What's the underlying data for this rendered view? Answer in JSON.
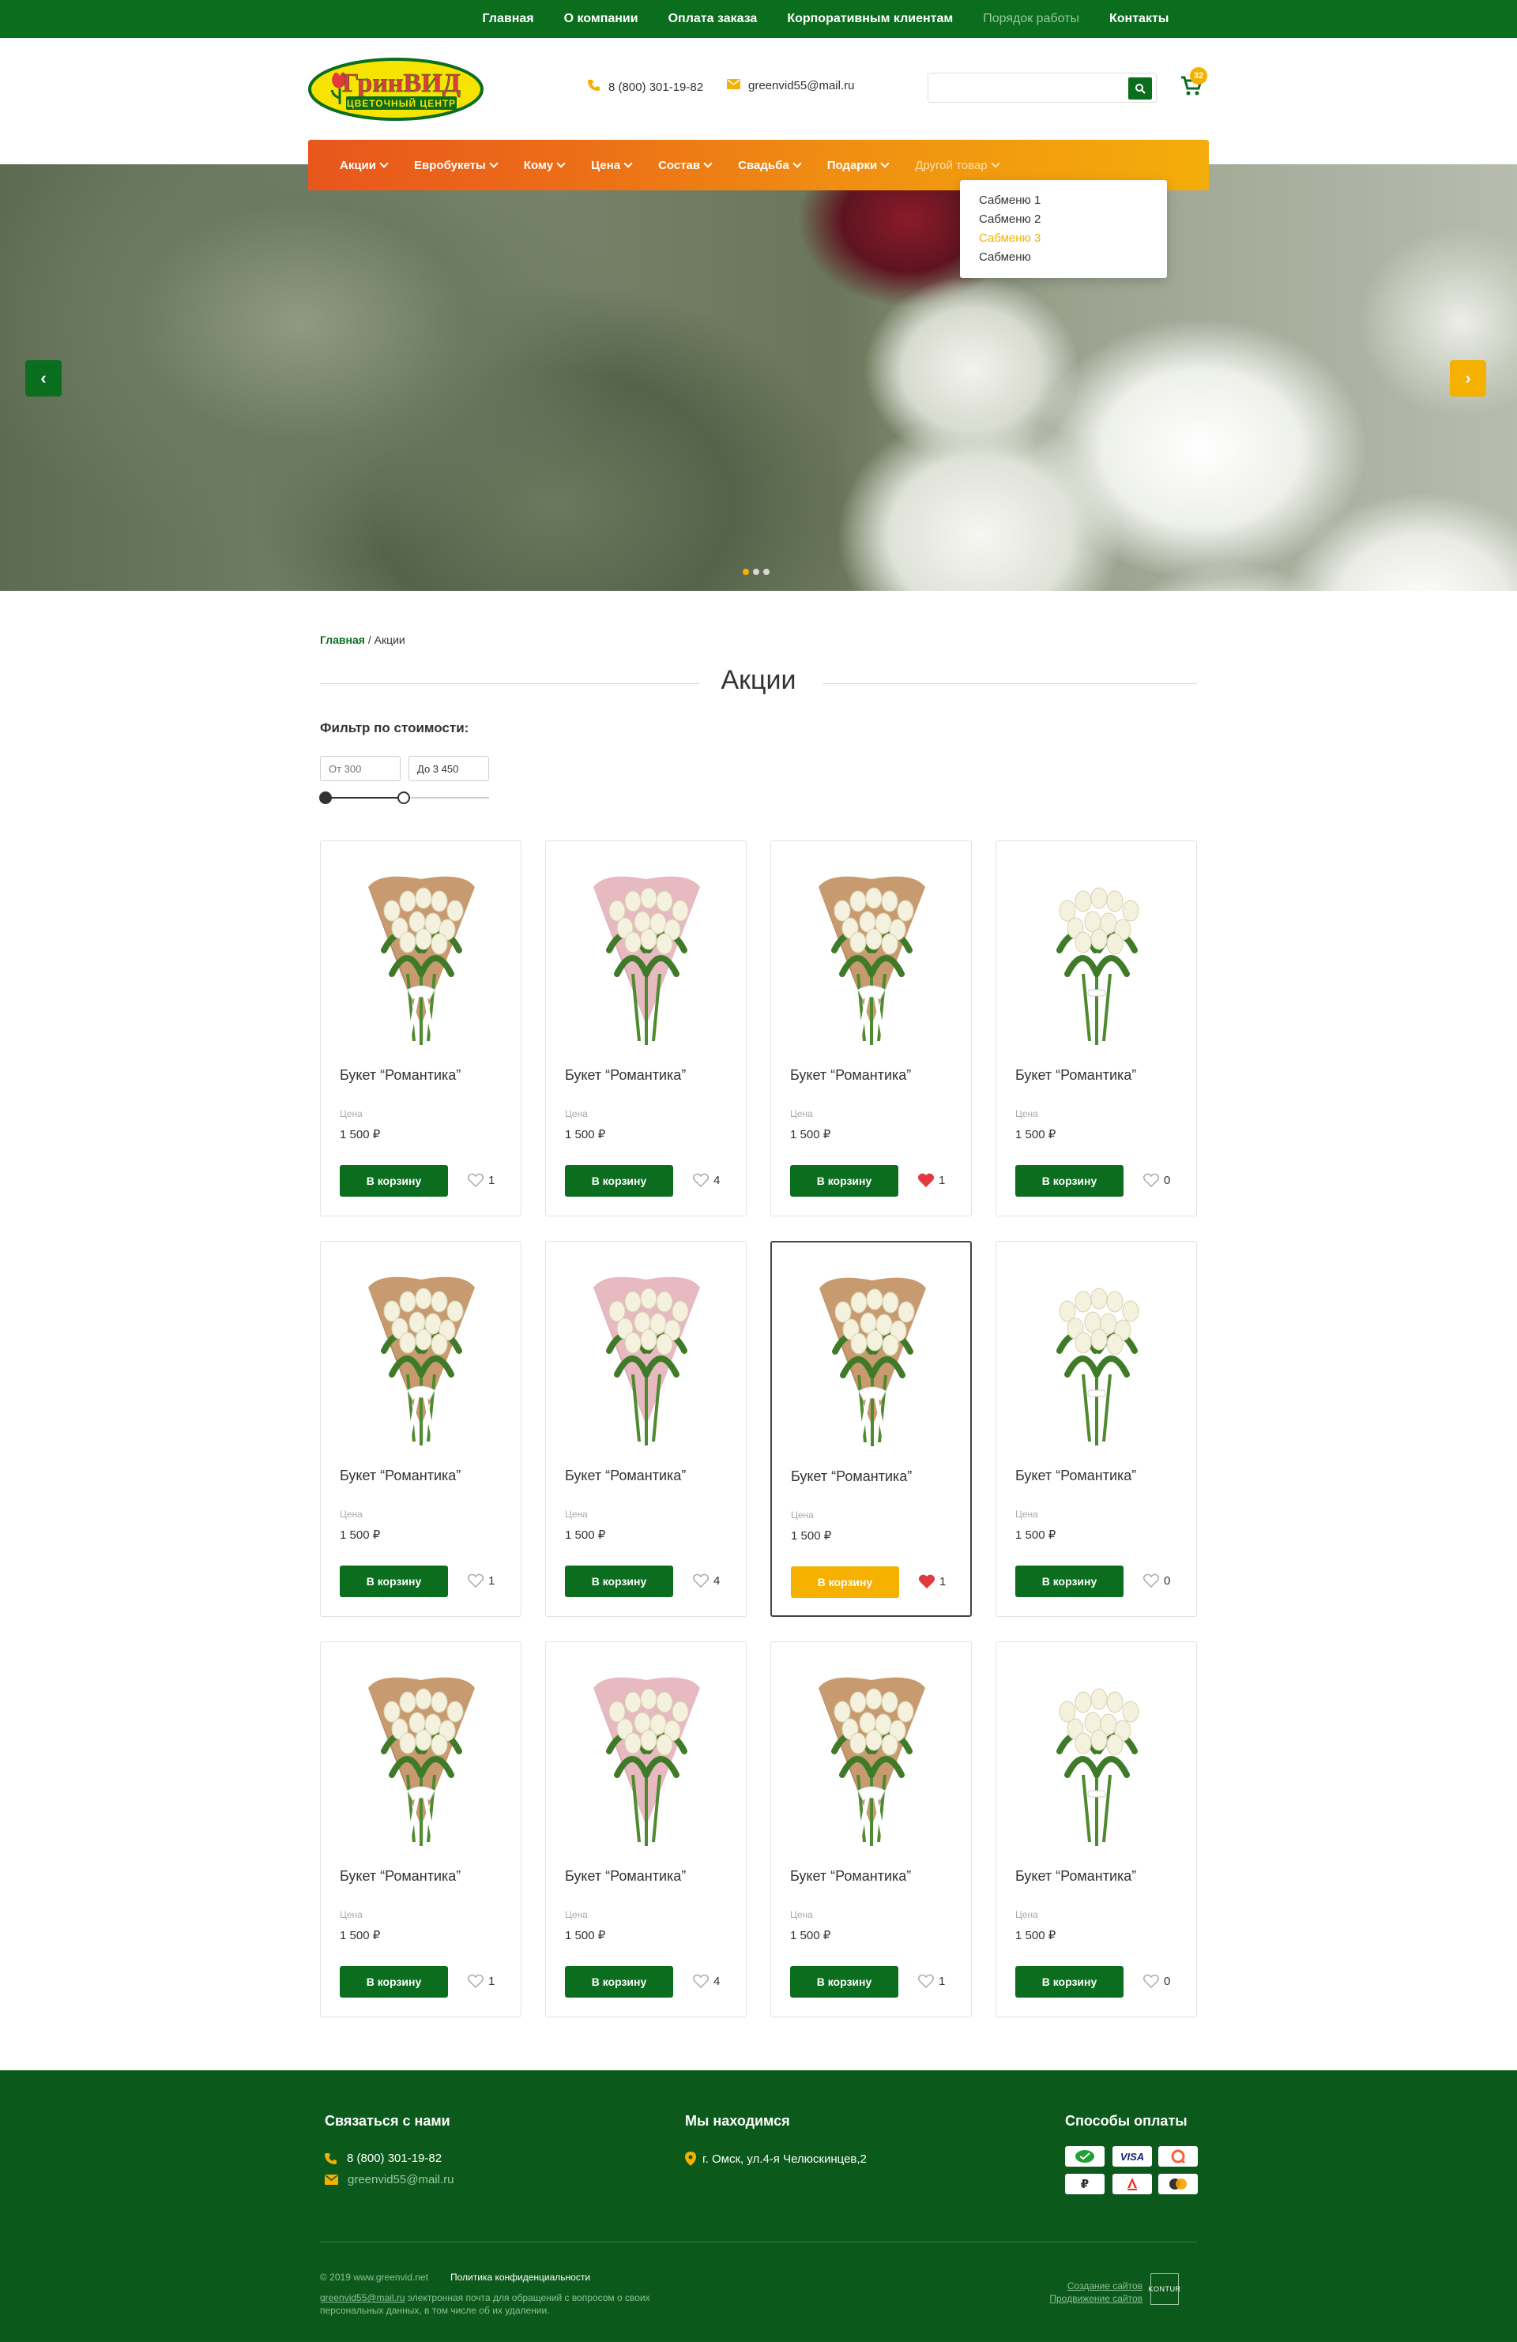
{
  "topnav": {
    "items": [
      {
        "label": "Главная"
      },
      {
        "label": "О компании"
      },
      {
        "label": "Оплата заказа"
      },
      {
        "label": "Корпоративным клиентам"
      },
      {
        "label": "Порядок работы"
      },
      {
        "label": "Контакты"
      }
    ]
  },
  "header": {
    "logo_text": "ГринВИД",
    "logo_subtitle": "ЦВЕТОЧНЫЙ ЦЕНТР",
    "phone": "8 (800) 301-19-82",
    "email": "greenvid55@mail.ru",
    "search_placeholder": "",
    "cart_count": "32"
  },
  "mainnav": {
    "items": [
      {
        "label": "Акции"
      },
      {
        "label": "Евробукеты"
      },
      {
        "label": "Кому"
      },
      {
        "label": "Цена"
      },
      {
        "label": "Состав"
      },
      {
        "label": "Свадьба"
      },
      {
        "label": "Подарки"
      },
      {
        "label": "Другой товар"
      }
    ],
    "dropdown": [
      {
        "label": "Сабменю 1"
      },
      {
        "label": "Сабменю 2"
      },
      {
        "label": "Сабменю 3"
      },
      {
        "label": "Сабменю"
      }
    ]
  },
  "hero": {
    "arrow_left": "‹",
    "arrow_right": "›",
    "slide_count": 3,
    "active_slide": 1
  },
  "breadcrumb": {
    "home": "Главная",
    "separator": " / ",
    "current": "Акции"
  },
  "page": {
    "title": "Акции",
    "filter_label": "Фильтр по стоимости:",
    "price_from_placeholder": "От 300",
    "price_to_value": "До 3 450"
  },
  "products": [
    {
      "name": "Букет “Романтика”",
      "price_label": "Цена",
      "price": "1 500 ₽",
      "buy_label": "В корзину",
      "likes": "1",
      "liked": false,
      "style": "kraft"
    },
    {
      "name": "Букет “Романтика”",
      "price_label": "Цена",
      "price": "1 500 ₽",
      "buy_label": "В корзину",
      "likes": "4",
      "liked": false,
      "style": "pink"
    },
    {
      "name": "Букет “Романтика”",
      "price_label": "Цена",
      "price": "1 500 ₽",
      "buy_label": "В корзину",
      "likes": "1",
      "liked": true,
      "style": "kraft"
    },
    {
      "name": "Букет “Романтика”",
      "price_label": "Цена",
      "price": "1 500 ₽",
      "buy_label": "В корзину",
      "likes": "0",
      "liked": false,
      "style": "white"
    },
    {
      "name": "Букет “Романтика”",
      "price_label": "Цена",
      "price": "1 500 ₽",
      "buy_label": "В корзину",
      "likes": "1",
      "liked": false,
      "style": "kraft"
    },
    {
      "name": "Букет “Романтика”",
      "price_label": "Цена",
      "price": "1 500 ₽",
      "buy_label": "В корзину",
      "likes": "4",
      "liked": false,
      "style": "pink"
    },
    {
      "name": "Букет “Романтика”",
      "price_label": "Цена",
      "price": "1 500 ₽",
      "buy_label": "В корзину",
      "likes": "1",
      "liked": true,
      "style": "kraft",
      "selected": true
    },
    {
      "name": "Букет “Романтика”",
      "price_label": "Цена",
      "price": "1 500 ₽",
      "buy_label": "В корзину",
      "likes": "0",
      "liked": false,
      "style": "white"
    },
    {
      "name": "Букет “Романтика”",
      "price_label": "Цена",
      "price": "1 500 ₽",
      "buy_label": "В корзину",
      "likes": "1",
      "liked": false,
      "style": "kraft"
    },
    {
      "name": "Букет “Романтика”",
      "price_label": "Цена",
      "price": "1 500 ₽",
      "buy_label": "В корзину",
      "likes": "4",
      "liked": false,
      "style": "pink"
    },
    {
      "name": "Букет “Романтика”",
      "price_label": "Цена",
      "price": "1 500 ₽",
      "buy_label": "В корзину",
      "likes": "1",
      "liked": false,
      "style": "kraft"
    },
    {
      "name": "Букет “Романтика”",
      "price_label": "Цена",
      "price": "1 500 ₽",
      "buy_label": "В корзину",
      "likes": "0",
      "liked": false,
      "style": "white"
    }
  ],
  "footer": {
    "contact_heading": "Связаться с нами",
    "phone": "8 (800) 301-19-82",
    "email": "greenvid55@mail.ru",
    "location_heading": "Мы находимся",
    "address": "г. Омск, ул.4-я Челюскинцев,2",
    "payment_heading": "Способы оплаты",
    "payment_methods": [
      "sberbank",
      "visa",
      "qiwi",
      "ruble",
      "alfa",
      "mastercard"
    ],
    "visa_text": "VISA",
    "copyright": "© 2019 www.greenvid.net",
    "privacy": "Политика конфиденциальности",
    "note_email": "greenvid55@mail.ru",
    "note_text": "электронная почта для обращений с вопросом о своих персональных данных, в том числе об их удалении.",
    "dev_line1": "Создание сайтов",
    "dev_line2": "Продвижение сайтов",
    "dev_brand": "KONTUR"
  },
  "colors": {
    "green": "#0b6e1e",
    "footer_green": "#0b5a1c",
    "yellow": "#f5b000",
    "orange_start": "#e8561c",
    "heart": "#e2393f"
  }
}
